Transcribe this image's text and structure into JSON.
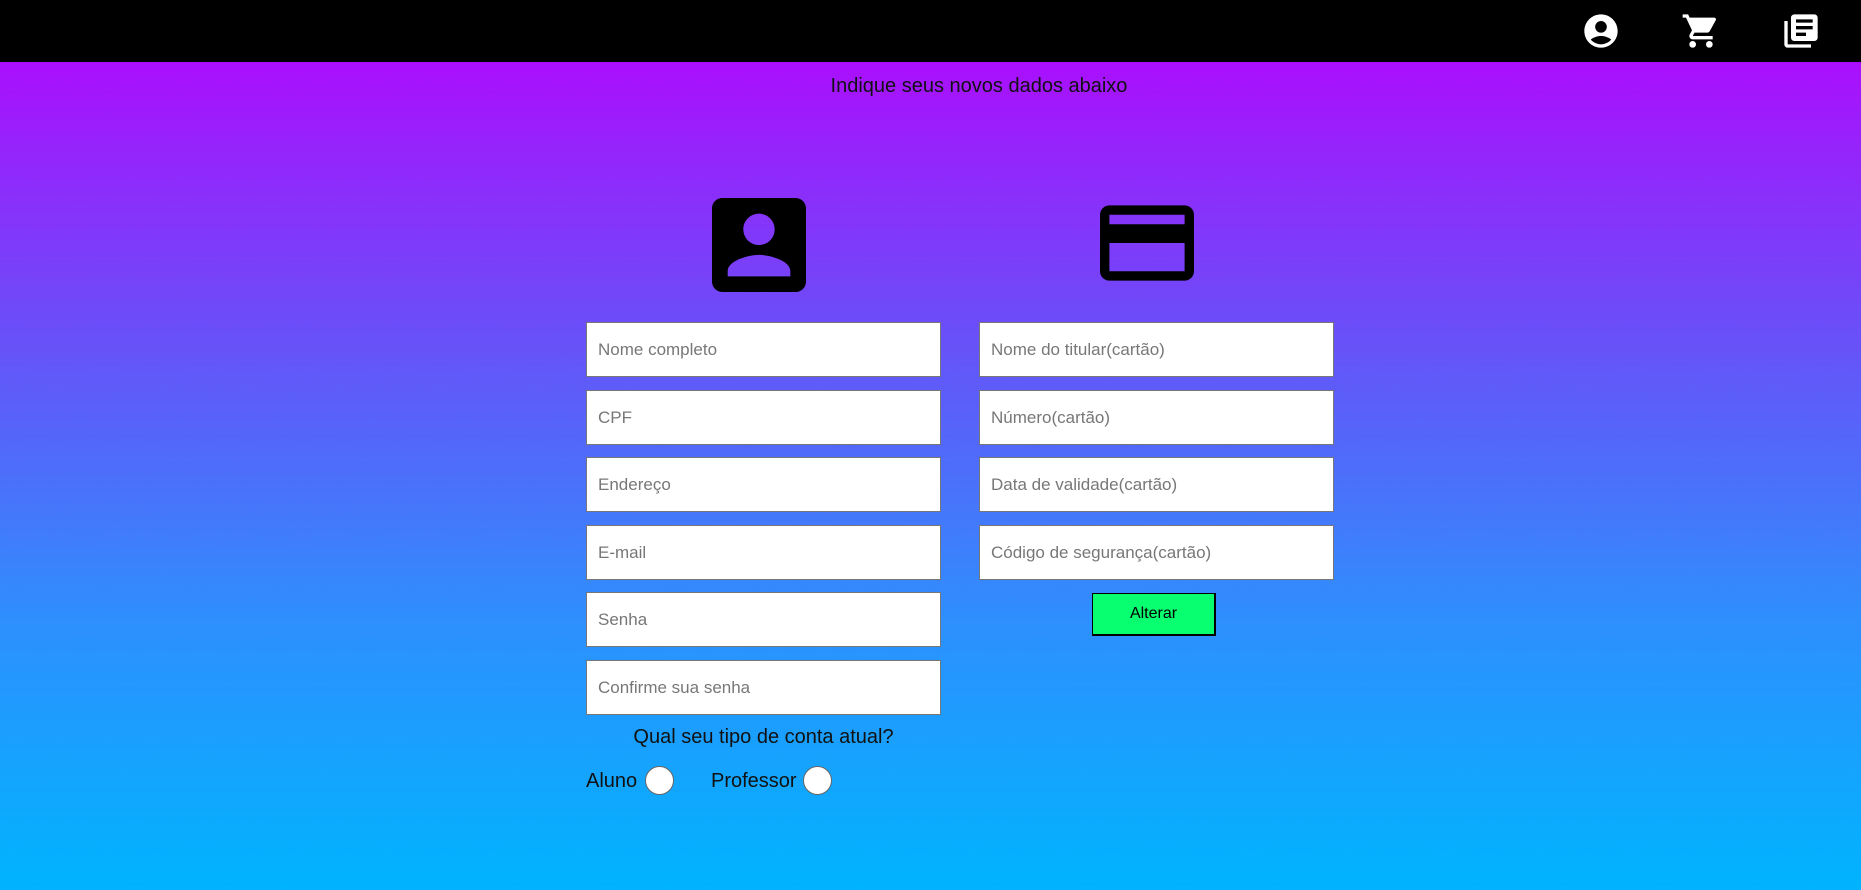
{
  "header": {
    "icons": [
      "account-circle-icon",
      "cart-icon",
      "library-icon"
    ]
  },
  "page": {
    "heading": "Indique seus novos dados abaixo"
  },
  "personal_form": {
    "icon": "account-box-icon",
    "fields": [
      {
        "placeholder": "Nome completo",
        "value": ""
      },
      {
        "placeholder": "CPF",
        "value": ""
      },
      {
        "placeholder": "Endereço",
        "value": ""
      },
      {
        "placeholder": "E-mail",
        "value": ""
      },
      {
        "placeholder": "Senha",
        "value": ""
      },
      {
        "placeholder": "Confirme sua senha",
        "value": ""
      }
    ],
    "account_type": {
      "question": "Qual seu tipo de conta atual?",
      "options": [
        {
          "label": "Aluno",
          "checked": false
        },
        {
          "label": "Professor",
          "checked": false
        }
      ]
    }
  },
  "card_form": {
    "icon": "credit-card-icon",
    "fields": [
      {
        "placeholder": "Nome do titular(cartão)",
        "value": ""
      },
      {
        "placeholder": "Número(cartão)",
        "value": ""
      },
      {
        "placeholder": "Data de validade(cartão)",
        "value": ""
      },
      {
        "placeholder": "Código de segurança(cartão)",
        "value": ""
      }
    ],
    "submit_label": "Alterar"
  },
  "colors": {
    "topbar": "#000000",
    "gradient_top": "#aa0ffd",
    "gradient_bottom": "#00b4ff",
    "button": "#08ff70"
  }
}
